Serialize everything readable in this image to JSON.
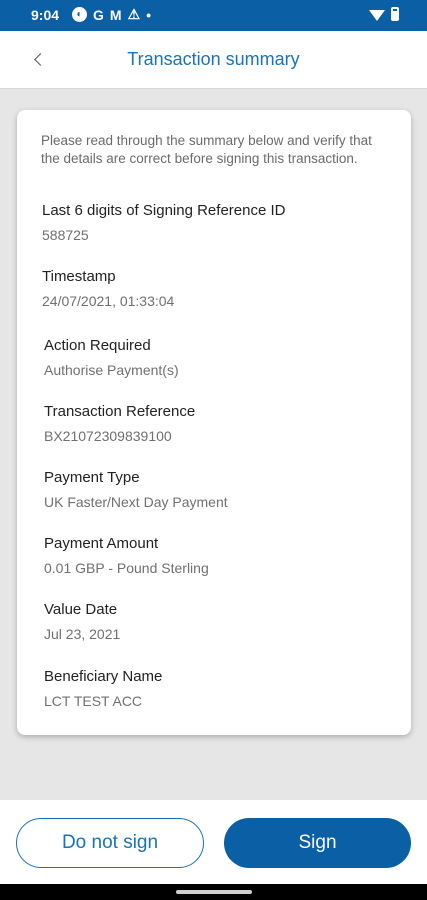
{
  "status_bar": {
    "time": "9:04",
    "icons": [
      "circle-g-icon",
      "google-icon",
      "gmail-icon",
      "warning-icon",
      "dot-icon",
      "wifi-icon",
      "battery-icon"
    ],
    "g_label": "G",
    "m_label": "M",
    "warning_label": "⚠",
    "dot_label": "•"
  },
  "header": {
    "title": "Transaction summary",
    "back_icon": "chevron-left-icon"
  },
  "summary": {
    "intro": "Please read through the summary below and verify that the details are correct before signing this transaction.",
    "fields": [
      {
        "label": "Last 6 digits of Signing Reference ID",
        "value": "588725"
      },
      {
        "label": "Timestamp",
        "value": "24/07/2021, 01:33:04"
      },
      {
        "label": "Action Required",
        "value": "Authorise Payment(s)"
      },
      {
        "label": "Transaction Reference",
        "value": "BX21072309839100"
      },
      {
        "label": "Payment Type",
        "value": "UK Faster/Next Day Payment"
      },
      {
        "label": "Payment Amount",
        "value": "0.01 GBP - Pound Sterling"
      },
      {
        "label": "Value Date",
        "value": "Jul 23, 2021"
      },
      {
        "label": "Beneficiary Name",
        "value": "LCT TEST ACC"
      }
    ]
  },
  "actions": {
    "decline_label": "Do not sign",
    "sign_label": "Sign"
  },
  "colors": {
    "brand": "#0a5fa5",
    "accent_text": "#1a73b8",
    "background": "#e6e6e6"
  }
}
